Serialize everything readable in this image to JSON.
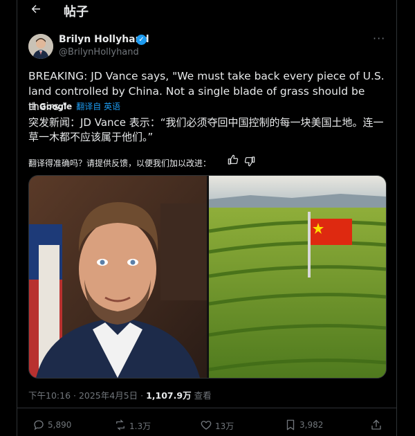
{
  "header": {
    "back_icon": "arrow-left-icon",
    "title": "帖子"
  },
  "author": {
    "name": "Brilyn Hollyhand",
    "handle": "@BrilynHollyhand",
    "verified": true,
    "verified_color": "#1d9bf0"
  },
  "tweet": {
    "text": "BREAKING: JD Vance says, \"We must take back every piece of U.S. land controlled by China. Not a single blade of grass should be theirs.\"",
    "translation": {
      "by_label": "由",
      "provider": "Google",
      "action_label": "翻译自 英语",
      "text": "突发新闻：JD Vance 表示：“我们必须夺回中国控制的每一块美国土地。连一草一木都不应该属于他们。”",
      "feedback_prompt": "翻译得准确吗？请提供反馈，以便我们加以改进："
    },
    "meta": {
      "time": "下午10:16 · 2025年4月5日 · ",
      "views": "1,107.9万",
      "views_label": " 查看"
    },
    "actions": {
      "replies": "5,890",
      "reposts": "1.3万",
      "likes": "13万",
      "bookmarks": "3,982"
    }
  },
  "colors": {
    "accent": "#1d9bf0",
    "background": "#000000",
    "muted": "#71767b"
  }
}
